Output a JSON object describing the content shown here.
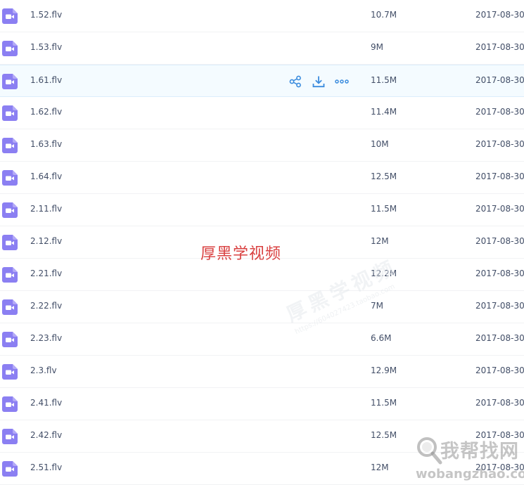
{
  "files": [
    {
      "name": "1.52.flv",
      "size": "10.7M",
      "date": "2017-08-30"
    },
    {
      "name": "1.53.flv",
      "size": "9M",
      "date": "2017-08-30"
    },
    {
      "name": "1.61.flv",
      "size": "11.5M",
      "date": "2017-08-30"
    },
    {
      "name": "1.62.flv",
      "size": "11.4M",
      "date": "2017-08-30"
    },
    {
      "name": "1.63.flv",
      "size": "10M",
      "date": "2017-08-30"
    },
    {
      "name": "1.64.flv",
      "size": "12.5M",
      "date": "2017-08-30"
    },
    {
      "name": "2.11.flv",
      "size": "11.5M",
      "date": "2017-08-30"
    },
    {
      "name": "2.12.flv",
      "size": "12M",
      "date": "2017-08-30"
    },
    {
      "name": "2.21.flv",
      "size": "12.2M",
      "date": "2017-08-30"
    },
    {
      "name": "2.22.flv",
      "size": "7M",
      "date": "2017-08-30"
    },
    {
      "name": "2.23.flv",
      "size": "6.6M",
      "date": "2017-08-30"
    },
    {
      "name": "2.3.flv",
      "size": "12.9M",
      "date": "2017-08-30"
    },
    {
      "name": "2.41.flv",
      "size": "11.5M",
      "date": "2017-08-30"
    },
    {
      "name": "2.42.flv",
      "size": "12.5M",
      "date": "2017-08-30"
    },
    {
      "name": "2.51.flv",
      "size": "12M",
      "date": "2017-08-30"
    }
  ],
  "hovered_row": 2,
  "row_actions": [
    {
      "icon": "share-icon",
      "label": "share"
    },
    {
      "icon": "download-icon",
      "label": "download"
    },
    {
      "icon": "more-icon",
      "label": "more"
    }
  ],
  "watermark": {
    "center_text": "厚黑学视频",
    "diagonal_text": "厚黑学视频",
    "diagonal_subtext": "https://604027423.taobao.com",
    "logo_text": "我帮找网",
    "logo_url": "wobangzhao.com"
  },
  "colors": {
    "video_icon": "#8b7ff2",
    "action_icon": "#3b8cde",
    "text": "#424e67",
    "hover_bg": "#f4fbff",
    "watermark_red": "#d94040"
  }
}
